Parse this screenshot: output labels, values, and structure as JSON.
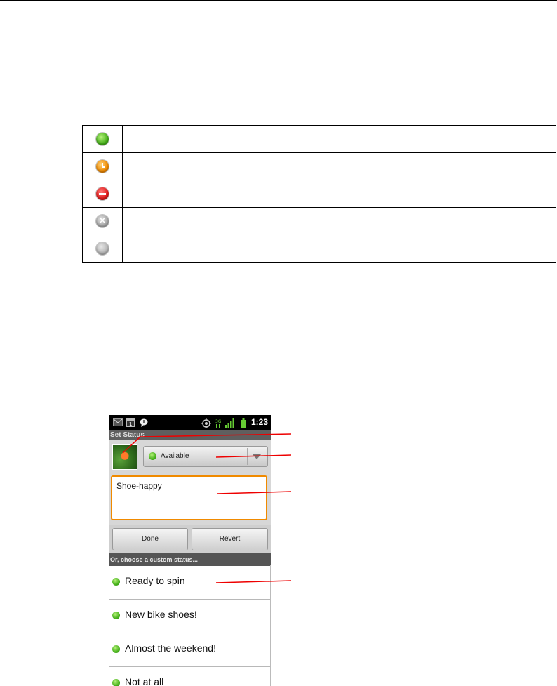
{
  "status_legend": [
    {
      "icon": "available-status-icon",
      "color": "#45b01a",
      "description": ""
    },
    {
      "icon": "idle-status-icon",
      "color": "#f08a00",
      "description": ""
    },
    {
      "icon": "busy-status-icon",
      "color": "#e21b1b",
      "description": ""
    },
    {
      "icon": "invisible-status-icon",
      "color": "#a8a8a8",
      "description": ""
    },
    {
      "icon": "offline-status-icon",
      "color": "#b5b5b5",
      "description": ""
    }
  ],
  "phone": {
    "status_bar": {
      "time": "1:23",
      "icons": [
        "gmail-icon",
        "calendar-icon",
        "talk-icon",
        "gps-icon",
        "data-icon",
        "signal-icon",
        "battery-icon"
      ]
    },
    "title": "Set Status",
    "status_select": {
      "value": "Available"
    },
    "status_message": "Shoe-happy",
    "buttons": {
      "done": "Done",
      "revert": "Revert"
    },
    "custom_header": "Or, choose a custom status...",
    "custom_statuses": [
      "Ready to spin",
      "New bike shoes!",
      "Almost the weekend!",
      "Not at all"
    ]
  },
  "colors": {
    "callout": "#e00000",
    "focus": "#f08a00"
  }
}
